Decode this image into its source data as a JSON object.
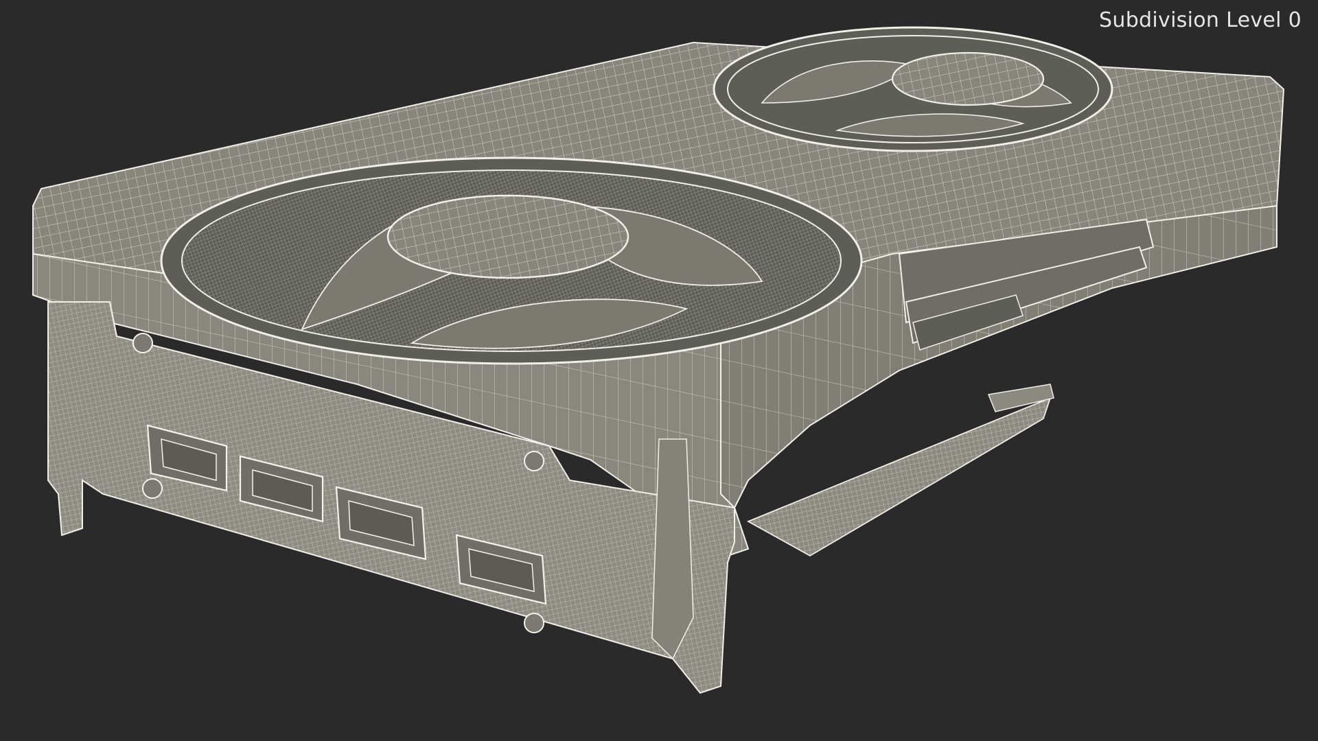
{
  "viewport": {
    "label": "Subdivision Level 0",
    "background_color": "#2a2a2a",
    "mesh_fill_color": "#8a8a80",
    "mesh_wire_color": "#f2f2ea",
    "subject": "graphics-card-wireframe"
  }
}
